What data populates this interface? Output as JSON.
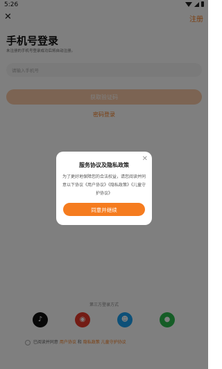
{
  "status_bar": {
    "time": "5:26"
  },
  "header": {
    "close_icon": "close-icon",
    "register_label": "注册"
  },
  "login": {
    "title": "手机号登录",
    "description": "未注册的手机号登录成功后将自动注册。",
    "phone_placeholder": "请输入手机号",
    "get_code_label": "获取验证码",
    "password_login_label": "密码登录"
  },
  "other_login": {
    "label": "第三方登录方式",
    "providers": [
      "douyin",
      "weibo",
      "qq",
      "wechat"
    ]
  },
  "agreement": {
    "prefix": "已阅读并同意",
    "user_agreement": "用户协议",
    "and": "和",
    "privacy_policy": "隐私政策",
    "children_policy": "儿童守护协议"
  },
  "dialog": {
    "title": "服务协议及隐私政策",
    "body": "为了更好地保障您的合法权益，请您阅读并同意以下协议《用户协议》《隐私政策》《儿童守护协议》",
    "agree_button": "同意并继续"
  },
  "colors": {
    "accent": "#f57c1f",
    "overlay": "rgba(0,0,0,0.5)"
  }
}
